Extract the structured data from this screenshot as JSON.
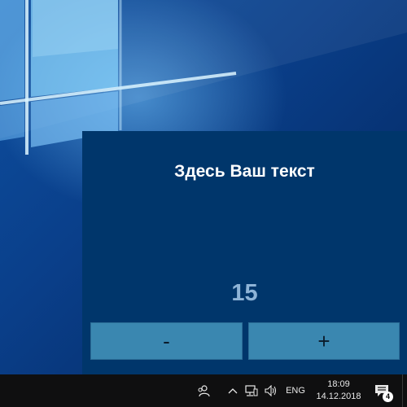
{
  "widget": {
    "title": "Здесь Ваш текст",
    "counter": "15",
    "minus_label": "-",
    "plus_label": "+"
  },
  "taskbar": {
    "language": "ENG",
    "time": "18:09",
    "date": "14.12.2018",
    "notification_count": "4",
    "icons": [
      "people-icon",
      "chevron-up-icon",
      "network-icon",
      "volume-icon",
      "action-center-icon"
    ]
  },
  "colors": {
    "widget_bg": "#00366b",
    "button_bg": "#3a87b0",
    "counter_text": "#8eb4d7",
    "taskbar_bg": "#0f0f10"
  }
}
